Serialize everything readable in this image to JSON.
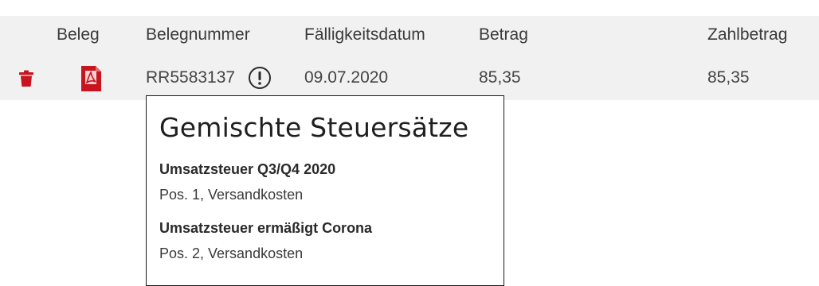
{
  "table": {
    "headers": {
      "beleg": "Beleg",
      "belegnummer": "Belegnummer",
      "faelligkeitsdatum": "Fälligkeitsdatum",
      "betrag": "Betrag",
      "zahlbetrag": "Zahlbetrag"
    },
    "rows": [
      {
        "belegnummer": "RR5583137",
        "faelligkeitsdatum": "09.07.2020",
        "betrag": "85,35",
        "zahlbetrag": "85,35",
        "icons": {
          "delete": "trash-icon",
          "document": "pdf-icon",
          "warning": "exclamation-circle-icon"
        }
      }
    ]
  },
  "popover": {
    "title": "Gemischte Steuersätze",
    "entries": [
      {
        "heading": "Umsatzsteuer Q3/Q4 2020",
        "text": "Pos. 1, Versandkosten"
      },
      {
        "heading": "Umsatzsteuer ermäßigt Corona",
        "text": "Pos. 2, Versandkosten"
      }
    ]
  },
  "colors": {
    "row_background": "#f1f1f1",
    "accent_red": "#c8141e",
    "text": "#3a3a3a"
  }
}
